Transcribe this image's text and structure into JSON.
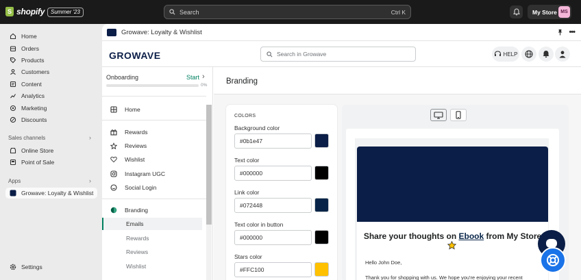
{
  "topbar": {
    "brand": "shopify",
    "brand_mark": "S",
    "edition": "Summer '23",
    "search_placeholder": "Search",
    "search_shortcut": "Ctrl K",
    "store_name": "My Store",
    "store_initials": "MS"
  },
  "nav": {
    "items": [
      {
        "label": "Home",
        "icon": "home-icon"
      },
      {
        "label": "Orders",
        "icon": "orders-icon"
      },
      {
        "label": "Products",
        "icon": "products-icon"
      },
      {
        "label": "Customers",
        "icon": "customers-icon"
      },
      {
        "label": "Content",
        "icon": "content-icon"
      },
      {
        "label": "Analytics",
        "icon": "analytics-icon"
      },
      {
        "label": "Marketing",
        "icon": "marketing-icon"
      },
      {
        "label": "Discounts",
        "icon": "discounts-icon"
      }
    ],
    "sales_channels_label": "Sales channels",
    "sales_channels": [
      {
        "label": "Online Store",
        "icon": "online-store-icon"
      },
      {
        "label": "Point of Sale",
        "icon": "pos-icon"
      }
    ],
    "apps_label": "Apps",
    "apps": [
      {
        "label": "Growave: Loyalty & Wishlist",
        "icon": "growave-app-icon"
      }
    ],
    "settings_label": "Settings"
  },
  "app": {
    "title": "Growave: Loyalty & Wishlist",
    "logo": "GROWAVE",
    "search_placeholder": "Search in Growave",
    "help_label": "HELP"
  },
  "onboarding": {
    "label": "Onboarding",
    "action": "Start",
    "percent": "0%",
    "progress": 0
  },
  "gw_nav": {
    "home": "Home",
    "group1": [
      {
        "label": "Rewards",
        "icon": "rewards-icon"
      },
      {
        "label": "Reviews",
        "icon": "reviews-icon"
      },
      {
        "label": "Wishlist",
        "icon": "wishlist-icon"
      },
      {
        "label": "Instagram UGC",
        "icon": "instagram-icon"
      },
      {
        "label": "Social Login",
        "icon": "social-login-icon"
      }
    ],
    "branding": "Branding",
    "branding_sub": [
      "Emails",
      "Rewards",
      "Reviews",
      "Wishlist"
    ]
  },
  "main": {
    "title": "Branding",
    "colors_heading": "COLORS",
    "fields": [
      {
        "label": "Background color",
        "value": "#0b1e47",
        "swatch": "#0b1e47"
      },
      {
        "label": "Text color",
        "value": "#000000",
        "swatch": "#000000"
      },
      {
        "label": "Link color",
        "value": "#072448",
        "swatch": "#072448"
      },
      {
        "label": "Text color in button",
        "value": "#000000",
        "swatch": "#000000"
      },
      {
        "label": "Stars color",
        "value": "#FFC100",
        "swatch": "#FFC100"
      }
    ]
  },
  "preview": {
    "heading_pre": "Share your thoughts on ",
    "heading_link": "Ebook",
    "heading_post": " from My Store",
    "hello": "Hello John Doe,",
    "thanks": "Thank you for shopping with us. We hope you're enjoying your recent"
  }
}
